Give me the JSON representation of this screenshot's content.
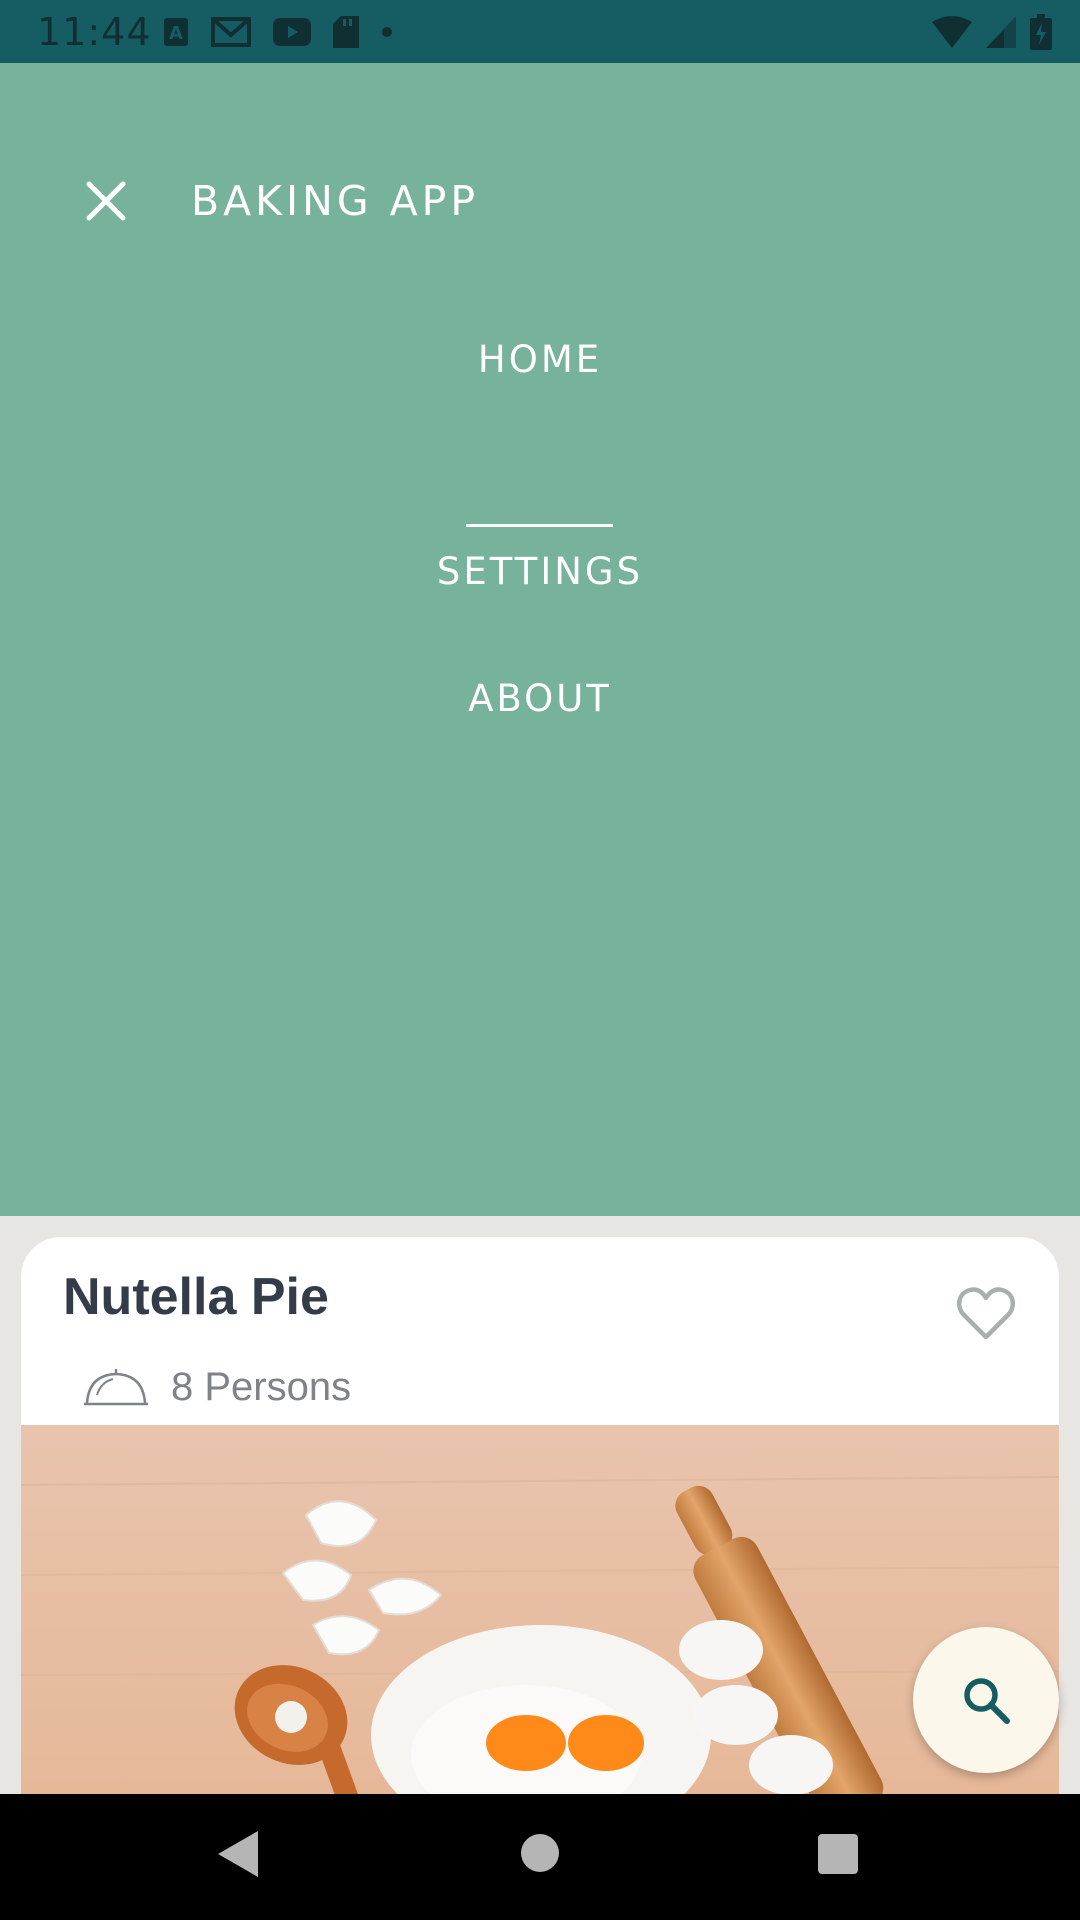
{
  "status_bar": {
    "time": "11:44",
    "left_icons": [
      "font-a-icon",
      "gmail-icon",
      "youtube-icon",
      "sd-card-icon",
      "dot-icon"
    ],
    "right_icons": [
      "wifi-icon",
      "signal-icon",
      "battery-charging-icon"
    ],
    "background": "#155c63"
  },
  "menu": {
    "app_title": "BAKING APP",
    "close_icon": "close-icon",
    "items": [
      {
        "label": "HOME",
        "selected": true
      },
      {
        "label": "SETTINGS",
        "selected": false
      },
      {
        "label": "ABOUT",
        "selected": false
      }
    ],
    "background": "#77b29a"
  },
  "recipe_card": {
    "title": "Nutella Pie",
    "servings": "8 Persons",
    "servings_icon": "cloche-icon",
    "favorite_icon": "heart-outline-icon",
    "image": "baking-ingredients-photo"
  },
  "fab": {
    "icon": "search-icon"
  },
  "nav_bar": {
    "icons": [
      "back-icon",
      "home-icon",
      "recents-icon"
    ]
  }
}
